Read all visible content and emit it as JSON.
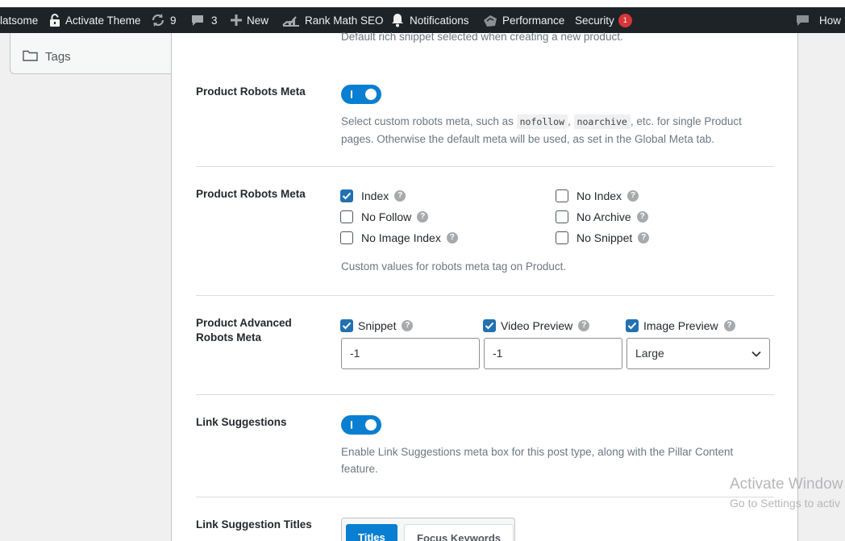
{
  "admin_bar": {
    "site_name": "latsome",
    "activate_theme": "Activate Theme",
    "updates_count": "9",
    "comments_count": "3",
    "new_label": "New",
    "rankmath_label": "Rank Math SEO",
    "notifications_label": "Notifications",
    "performance_label": "Performance",
    "security_label": "Security",
    "security_badge": "1",
    "howdy_label": "How"
  },
  "sidebar": {
    "tags_label": "Tags"
  },
  "top_note": "Default rich snippet selected when creating a new product.",
  "robots_meta_toggle": {
    "label": "Product Robots Meta",
    "state": "on",
    "desc_prefix": "Select custom robots meta, such as",
    "code1": "nofollow",
    "sep": ",",
    "code2": "noarchive",
    "desc_suffix": ", etc. for single Product",
    "desc_line2": "pages. Otherwise the default meta will be used, as set in the Global Meta tab."
  },
  "robots_meta_checks": {
    "label": "Product Robots Meta",
    "options": [
      {
        "label": "Index",
        "checked": true
      },
      {
        "label": "No Follow",
        "checked": false
      },
      {
        "label": "No Image Index",
        "checked": false
      },
      {
        "label": "No Index",
        "checked": false
      },
      {
        "label": "No Archive",
        "checked": false
      },
      {
        "label": "No Snippet",
        "checked": false
      }
    ],
    "desc": "Custom values for robots meta tag on Product."
  },
  "advanced_robots": {
    "label_line1": "Product Advanced",
    "label_line2": "Robots Meta",
    "snippet_label": "Snippet",
    "snippet_value": "-1",
    "video_label": "Video Preview",
    "video_value": "-1",
    "image_label": "Image Preview",
    "image_value": "Large"
  },
  "link_suggestions": {
    "label": "Link Suggestions",
    "state": "on",
    "desc_line1": "Enable Link Suggestions meta box for this post type, along with the Pillar Content",
    "desc_line2": "feature."
  },
  "link_suggestion_titles": {
    "label": "Link Suggestion Titles",
    "option_active": "Titles",
    "option_inactive": "Focus Keywords"
  },
  "watermark": {
    "line1": "Activate Window",
    "line2": "Go to Settings to activ"
  },
  "colors": {
    "accent": "#0a7fd1",
    "checkbox_checked": "#2271b1",
    "admin_bar": "#1d2327",
    "badge": "#d63638"
  }
}
